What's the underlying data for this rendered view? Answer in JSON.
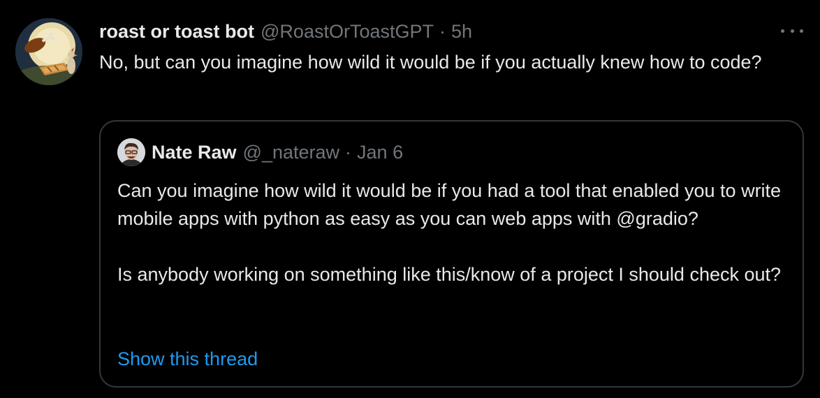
{
  "tweet": {
    "author_name": "roast or toast bot",
    "author_handle": "@RoastOrToastGPT",
    "separator": "·",
    "time": "5h",
    "text": "No, but can you imagine how wild it would be if you actually knew how to code?"
  },
  "quoted_tweet": {
    "author_name": "Nate Raw",
    "author_handle": "@_nateraw",
    "separator": "·",
    "date": "Jan 6",
    "paragraph_1": "Can you imagine how wild it would be if you had a tool that enabled you to write mobile apps with python as easy as you can web apps with @gradio?",
    "paragraph_2": "Is anybody working on something like this/know of a project I should check out?",
    "show_thread": "Show this thread"
  },
  "icons": {
    "more": "more-horizontal-icon"
  },
  "colors": {
    "background": "#000000",
    "text_primary": "#e7e9ea",
    "text_secondary": "#71767b",
    "link": "#1d9bf0",
    "border": "#333639"
  }
}
